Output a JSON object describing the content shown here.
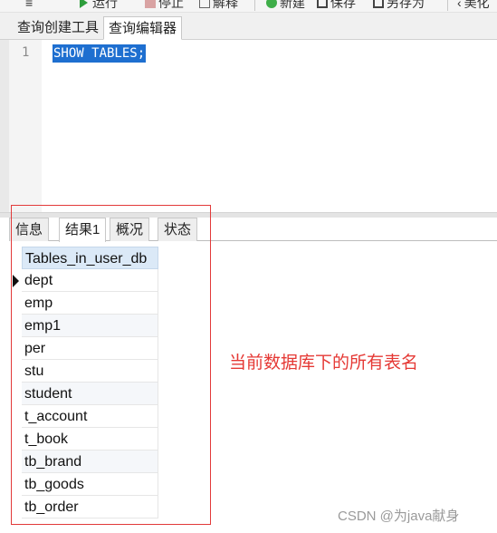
{
  "toolbar": {
    "run_label": "运行",
    "stop_label": "停止",
    "explain_label": "解释",
    "new_label": "新建",
    "save_label": "保存",
    "save_as_label": "另存为",
    "beautify_label": "美化"
  },
  "editor_tabs": {
    "query_builder": "查询创建工具",
    "query_editor": "查询编辑器"
  },
  "editor": {
    "line_number": "1",
    "code": "SHOW TABLES;"
  },
  "result_tabs": {
    "info": "信息",
    "result1": "结果1",
    "profile": "概况",
    "status": "状态"
  },
  "table": {
    "header": "Tables_in_user_db",
    "rows": [
      "dept",
      "emp",
      "emp1",
      "per",
      "stu",
      "student",
      "t_account",
      "t_book",
      "tb_brand",
      "tb_goods",
      "tb_order"
    ]
  },
  "annotation": "当前数据库下的所有表名",
  "watermark": "CSDN @为java献身",
  "colors": {
    "selection": "#1e6fd0",
    "annotation_red": "#e53935",
    "header_bg": "#dbe9f7"
  }
}
